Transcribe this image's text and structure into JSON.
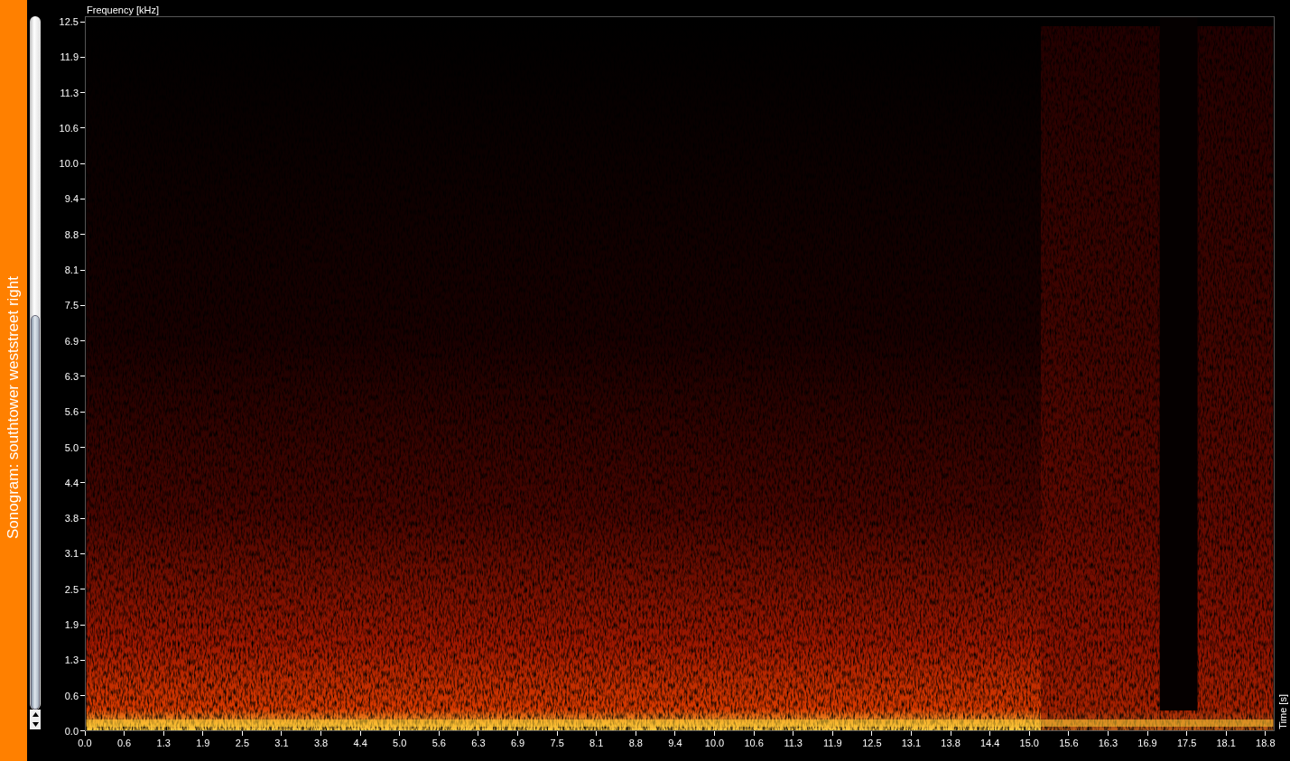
{
  "sidebar": {
    "title": "Sonogram: southtower weststreet right"
  },
  "plot": {
    "y_axis_label": "Frequency [kHz]",
    "x_axis_label": "Time [s]",
    "y_ticks": [
      "12.5",
      "11.9",
      "11.3",
      "10.6",
      "10.0",
      "9.4",
      "8.8",
      "8.1",
      "7.5",
      "6.9",
      "6.3",
      "5.6",
      "5.0",
      "4.4",
      "3.8",
      "3.1",
      "2.5",
      "1.9",
      "1.3",
      "0.6",
      "0.0"
    ],
    "x_ticks": [
      "0.0",
      "0.6",
      "1.3",
      "1.9",
      "2.5",
      "3.1",
      "3.8",
      "4.4",
      "5.0",
      "5.6",
      "6.3",
      "6.9",
      "7.5",
      "8.1",
      "8.8",
      "9.4",
      "10.0",
      "10.6",
      "11.3",
      "11.9",
      "12.5",
      "13.1",
      "13.8",
      "14.4",
      "15.0",
      "15.6",
      "16.3",
      "16.9",
      "17.5",
      "18.1",
      "18.8"
    ]
  }
}
